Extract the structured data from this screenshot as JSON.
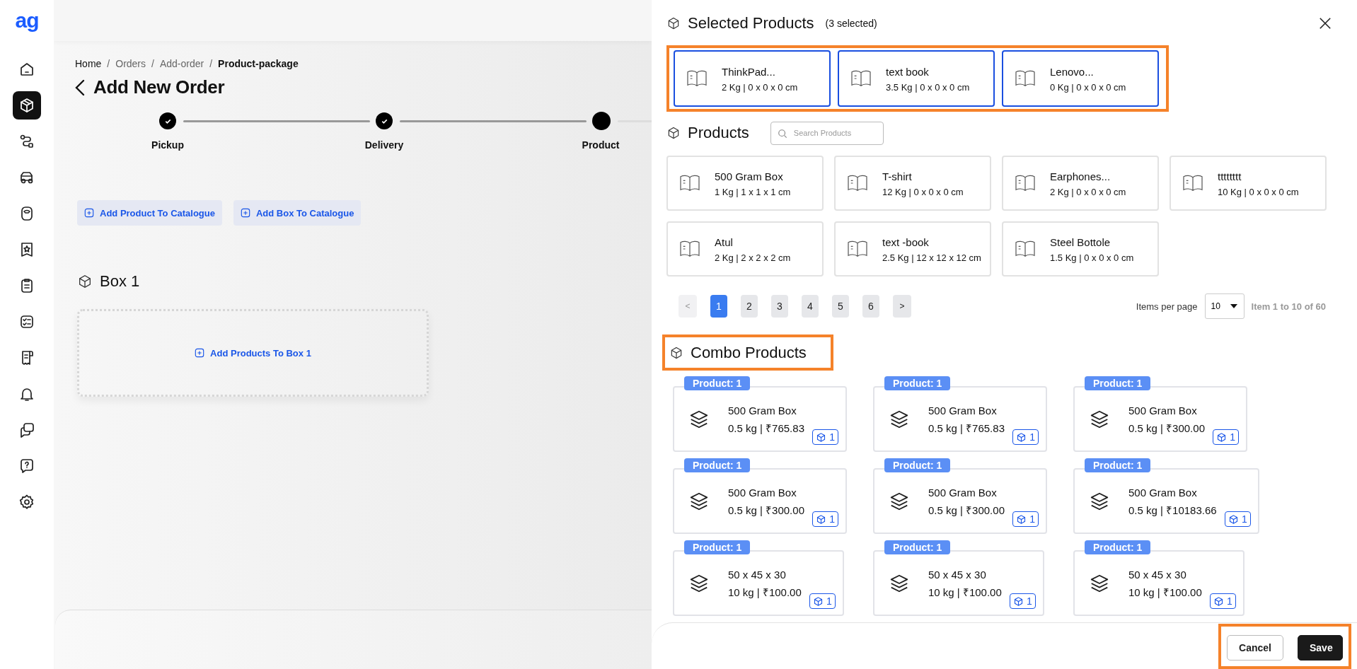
{
  "sidebar": {
    "logo": "ag",
    "items": [
      {
        "selected": false
      },
      {
        "selected": true
      },
      {
        "selected": false
      },
      {
        "selected": false
      },
      {
        "selected": false
      },
      {
        "selected": false
      },
      {
        "selected": false
      },
      {
        "selected": false
      },
      {
        "selected": false
      },
      {
        "selected": false
      },
      {
        "selected": false
      },
      {
        "selected": false
      },
      {
        "selected": false
      }
    ]
  },
  "breadcrumb": [
    {
      "label": "Home",
      "current": false
    },
    {
      "label": "Orders",
      "current": false
    },
    {
      "label": "Add-order",
      "current": false
    },
    {
      "label": "Product-package",
      "current": true
    }
  ],
  "breadcrumb_separator": "/",
  "page_title": "Add New Order",
  "steps": [
    {
      "label": "Pickup",
      "completed": true
    },
    {
      "label": "Delivery",
      "completed": true
    },
    {
      "label": "Product",
      "completed": false
    }
  ],
  "catalogue_buttons": [
    "Add Product To Catalogue",
    "Add Box To Catalogue"
  ],
  "box": {
    "title": "Box 1",
    "add_label": "Add Products To Box 1"
  },
  "drawer": {
    "title": "Selected Products",
    "selected_count": "(3 selected)",
    "selected_products": {
      "highlighted": true,
      "items": [
        {
          "name": "ThinkPad...",
          "details": "2 Kg | 0 x 0 x 0 cm"
        },
        {
          "name": "text book",
          "details": "3.5 Kg | 0 x 0 x 0 cm"
        },
        {
          "name": "Lenovo...",
          "details": "0 Kg | 0 x 0 x 0 cm"
        }
      ]
    },
    "products": {
      "title": "Products",
      "search": {
        "placeholder": "Search Products"
      },
      "items": [
        {
          "name": "500 Gram Box",
          "details": "1 Kg | 1 x 1 x 1 cm"
        },
        {
          "name": "T-shirt",
          "details": "12 Kg | 0 x 0 x 0 cm"
        },
        {
          "name": "Earphones...",
          "details": "2 Kg | 0 x 0 x 0 cm"
        },
        {
          "name": "tttttttt",
          "details": "10 Kg | 0 x 0 x 0 cm"
        },
        {
          "name": "Atul",
          "details": "2 Kg | 2 x 2 x 2 cm"
        },
        {
          "name": "text -book",
          "details": "2.5 Kg | 12 x 12 x 12 cm"
        },
        {
          "name": "Steel Bottole",
          "details": "1.5 Kg | 0 x 0 x 0 cm"
        }
      ]
    },
    "pagination": {
      "prev": {
        "label": "<",
        "disabled": true
      },
      "next": {
        "label": ">",
        "disabled": false
      },
      "pages": [
        {
          "label": "1",
          "selected": true
        },
        {
          "label": "2",
          "selected": false
        },
        {
          "label": "3",
          "selected": false
        },
        {
          "label": "4",
          "selected": false
        },
        {
          "label": "5",
          "selected": false
        },
        {
          "label": "6",
          "selected": false
        }
      ],
      "per_page_label": "Items per page",
      "per_page": "10",
      "range": "Item 1 to 10 of 60"
    },
    "combo_products": {
      "title": "Combo Products",
      "highlighted": true,
      "items": [
        {
          "badge": "Product: 1",
          "name": "500 Gram Box",
          "details": "0.5 kg | ₹765.83",
          "count": "1"
        },
        {
          "badge": "Product: 1",
          "name": "500 Gram Box",
          "details": "0.5 kg | ₹765.83",
          "count": "1"
        },
        {
          "badge": "Product: 1",
          "name": "500 Gram Box",
          "details": "0.5 kg | ₹300.00",
          "count": "1"
        },
        {
          "badge": "Product: 1",
          "name": "500 Gram Box",
          "details": "0.5 kg | ₹300.00",
          "count": "1"
        },
        {
          "badge": "Product: 1",
          "name": "500 Gram Box",
          "details": "0.5 kg | ₹300.00",
          "count": "1"
        },
        {
          "badge": "Product: 1",
          "name": "500 Gram Box",
          "details": "0.5 kg | ₹10183.66",
          "count": "1"
        },
        {
          "badge": "Product: 1",
          "name": "50 x 45 x 30",
          "details": "10 kg | ₹100.00",
          "count": "1"
        },
        {
          "badge": "Product: 1",
          "name": "50 x 45 x 30",
          "details": "10 kg | ₹100.00",
          "count": "1"
        },
        {
          "badge": "Product: 1",
          "name": "50 x 45 x 30",
          "details": "10 kg | ₹100.00",
          "count": "1"
        }
      ]
    },
    "footer": {
      "highlighted": true,
      "buttons": [
        {
          "label": "Cancel",
          "kind": "secondary"
        },
        {
          "label": "Save",
          "kind": "primary"
        }
      ]
    }
  }
}
